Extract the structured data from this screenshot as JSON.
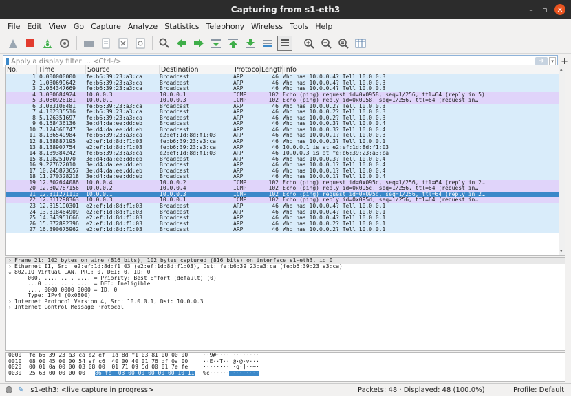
{
  "title": "Capturing from s1-eth3",
  "menu": [
    "File",
    "Edit",
    "View",
    "Go",
    "Capture",
    "Analyze",
    "Statistics",
    "Telephony",
    "Wireless",
    "Tools",
    "Help"
  ],
  "filter_placeholder": "Apply a display filter … <Ctrl-/>",
  "columns": [
    "No.",
    "Time",
    "Source",
    "Destination",
    "Protocol",
    "Length",
    "Info"
  ],
  "packets": [
    {
      "no": "1",
      "time": "0.000000000",
      "src": "fe:b6:39:23:a3:ca",
      "dst": "Broadcast",
      "proto": "ARP",
      "len": "46",
      "info": "Who has 10.0.0.4? Tell 10.0.0.3",
      "bg": "#d9ecfa"
    },
    {
      "no": "2",
      "time": "1.030699642",
      "src": "fe:b6:39:23:a3:ca",
      "dst": "Broadcast",
      "proto": "ARP",
      "len": "46",
      "info": "Who has 10.0.0.4? Tell 10.0.0.3",
      "bg": "#d9ecfa"
    },
    {
      "no": "3",
      "time": "2.054347669",
      "src": "fe:b6:39:23:a3:ca",
      "dst": "Broadcast",
      "proto": "ARP",
      "len": "46",
      "info": "Who has 10.0.0.4? Tell 10.0.0.3",
      "bg": "#d9ecfa"
    },
    {
      "no": "4",
      "time": "3.080684924",
      "src": "10.0.0.3",
      "dst": "10.0.0.1",
      "proto": "ICMP",
      "len": "102",
      "info": "Echo (ping) request  id=0x0958, seq=1/256, ttl=64 (reply in 5)",
      "bg": "#e0d4fa"
    },
    {
      "no": "5",
      "time": "3.080926181",
      "src": "10.0.0.1",
      "dst": "10.0.0.3",
      "proto": "ICMP",
      "len": "102",
      "info": "Echo (ping) reply    id=0x0958, seq=1/256, ttl=64 (request in…",
      "bg": "#e0d4fa"
    },
    {
      "no": "6",
      "time": "3.083108481",
      "src": "fe:b6:39:23:a3:ca",
      "dst": "Broadcast",
      "proto": "ARP",
      "len": "46",
      "info": "Who has 10.0.0.2? Tell 10.0.0.3",
      "bg": "#d9ecfa"
    },
    {
      "no": "7",
      "time": "4.102335516",
      "src": "fe:b6:39:23:a3:ca",
      "dst": "Broadcast",
      "proto": "ARP",
      "len": "46",
      "info": "Who has 10.0.0.2? Tell 10.0.0.3",
      "bg": "#d9ecfa"
    },
    {
      "no": "8",
      "time": "5.126351697",
      "src": "fe:b6:39:23:a3:ca",
      "dst": "Broadcast",
      "proto": "ARP",
      "len": "46",
      "info": "Who has 10.0.0.2? Tell 10.0.0.3",
      "bg": "#d9ecfa"
    },
    {
      "no": "9",
      "time": "6.158436136",
      "src": "3e:d4:da:ee:dd:eb",
      "dst": "Broadcast",
      "proto": "ARP",
      "len": "46",
      "info": "Who has 10.0.0.3? Tell 10.0.0.4",
      "bg": "#d9ecfa"
    },
    {
      "no": "10",
      "time": "7.174366747",
      "src": "3e:d4:da:ee:dd:eb",
      "dst": "Broadcast",
      "proto": "ARP",
      "len": "46",
      "info": "Who has 10.0.0.3? Tell 10.0.0.4",
      "bg": "#d9ecfa"
    },
    {
      "no": "11",
      "time": "8.136549984",
      "src": "fe:b6:39:23:a3:ca",
      "dst": "e2:ef:1d:8d:f1:03",
      "proto": "ARP",
      "len": "46",
      "info": "Who has 10.0.0.1? Tell 10.0.0.3",
      "bg": "#d9ecfa"
    },
    {
      "no": "12",
      "time": "8.138887195",
      "src": "e2:ef:1d:8d:f1:03",
      "dst": "fe:b6:39:23:a3:ca",
      "proto": "ARP",
      "len": "46",
      "info": "Who has 10.0.0.3? Tell 10.0.0.1",
      "bg": "#d9ecfa"
    },
    {
      "no": "13",
      "time": "8.138907754",
      "src": "e2:ef:1d:8d:f1:03",
      "dst": "fe:b6:39:23:a3:ca",
      "proto": "ARP",
      "len": "46",
      "info": "10.0.0.1 is at e2:ef:1d:8d:f1:03",
      "bg": "#d9ecfa"
    },
    {
      "no": "14",
      "time": "8.139384242",
      "src": "fe:b6:39:23:a3:ca",
      "dst": "e2:ef:1d:8d:f1:03",
      "proto": "ARP",
      "len": "46",
      "info": "10.0.0.3 is at fe:b6:39:23:a3:ca",
      "bg": "#d9ecfa"
    },
    {
      "no": "15",
      "time": "8.198251070",
      "src": "3e:d4:da:ee:dd:eb",
      "dst": "Broadcast",
      "proto": "ARP",
      "len": "46",
      "info": "Who has 10.0.0.3? Tell 10.0.0.4",
      "bg": "#d9ecfa"
    },
    {
      "no": "16",
      "time": "9.227622010",
      "src": "3e:d4:da:ee:dd:eb",
      "dst": "Broadcast",
      "proto": "ARP",
      "len": "46",
      "info": "Who has 10.0.0.1? Tell 10.0.0.4",
      "bg": "#d9ecfa"
    },
    {
      "no": "17",
      "time": "10.245873657",
      "src": "3e:d4:da:ee:dd:eb",
      "dst": "Broadcast",
      "proto": "ARP",
      "len": "46",
      "info": "Who has 10.0.0.1? Tell 10.0.0.4",
      "bg": "#d9ecfa"
    },
    {
      "no": "18",
      "time": "11.270328218",
      "src": "3e:d4:da:ee:dd:eb",
      "dst": "Broadcast",
      "proto": "ARP",
      "len": "46",
      "info": "Who has 10.0.0.1? Tell 10.0.0.4",
      "bg": "#d9ecfa"
    },
    {
      "no": "19",
      "time": "12.302644086",
      "src": "10.0.0.4",
      "dst": "10.0.0.2",
      "proto": "ICMP",
      "len": "102",
      "info": "Echo (ping) request  id=0x095c, seq=1/256, ttl=64 (reply in 2…",
      "bg": "#e0d4fa"
    },
    {
      "no": "20",
      "time": "12.302787156",
      "src": "10.0.0.2",
      "dst": "10.0.0.4",
      "proto": "ICMP",
      "len": "102",
      "info": "Echo (ping) reply    id=0x095c, seq=1/256, ttl=64 (request in…",
      "bg": "#e0d4fa"
    },
    {
      "no": "21",
      "time": "12.311271113",
      "src": "10.0.0.1",
      "dst": "10.0.0.3",
      "proto": "ICMP",
      "len": "102",
      "info": "Echo (ping) request  id=0x095d, seq=1/256, ttl=64 (reply in 2…",
      "bg": "#3b88c9",
      "sel": true
    },
    {
      "no": "22",
      "time": "12.311298363",
      "src": "10.0.0.3",
      "dst": "10.0.0.1",
      "proto": "ICMP",
      "len": "102",
      "info": "Echo (ping) reply    id=0x095d, seq=1/256, ttl=64 (request in…",
      "bg": "#e0d4fa"
    },
    {
      "no": "23",
      "time": "12.315190301",
      "src": "e2:ef:1d:8d:f1:03",
      "dst": "Broadcast",
      "proto": "ARP",
      "len": "46",
      "info": "Who has 10.0.0.4? Tell 10.0.0.1",
      "bg": "#d9ecfa"
    },
    {
      "no": "24",
      "time": "13.318464909",
      "src": "e2:ef:1d:8d:f1:03",
      "dst": "Broadcast",
      "proto": "ARP",
      "len": "46",
      "info": "Who has 10.0.0.4? Tell 10.0.0.1",
      "bg": "#d9ecfa"
    },
    {
      "no": "25",
      "time": "14.343951666",
      "src": "e2:ef:1d:8d:f1:03",
      "dst": "Broadcast",
      "proto": "ARP",
      "len": "46",
      "info": "Who has 10.0.0.4? Tell 10.0.0.1",
      "bg": "#d9ecfa"
    },
    {
      "no": "26",
      "time": "15.372892396",
      "src": "e2:ef:1d:8d:f1:03",
      "dst": "Broadcast",
      "proto": "ARP",
      "len": "46",
      "info": "Who has 10.0.0.2? Tell 10.0.0.1",
      "bg": "#d9ecfa"
    },
    {
      "no": "27",
      "time": "16.390675962",
      "src": "e2:ef:1d:8d:f1:03",
      "dst": "Broadcast",
      "proto": "ARP",
      "len": "46",
      "info": "Who has 10.0.0.2? Tell 10.0.0.1",
      "bg": "#d9ecfa"
    }
  ],
  "details": [
    {
      "arrow": "›",
      "text": "Frame 21: 102 bytes on wire (816 bits), 102 bytes captured (816 bits) on interface s1-eth3, id 0"
    },
    {
      "arrow": "›",
      "text": "Ethernet II, Src: e2:ef:1d:8d:f1:03 (e2:ef:1d:8d:f1:03), Dst: fe:b6:39:23:a3:ca (fe:b6:39:23:a3:ca)"
    },
    {
      "arrow": "⌄",
      "text": "802.1Q Virtual LAN, PRI: 0, DEI: 0, ID: 0"
    },
    {
      "arrow": "",
      "text": "    000. .... .... .... = Priority: Best Effort (default) (0)"
    },
    {
      "arrow": "",
      "text": "    ...0 .... .... .... = DEI: Ineligible"
    },
    {
      "arrow": "",
      "text": "    .... 0000 0000 0000 = ID: 0"
    },
    {
      "arrow": "",
      "text": "    Type: IPv4 (0x0800)"
    },
    {
      "arrow": "›",
      "text": "Internet Protocol Version 4, Src: 10.0.0.1, Dst: 10.0.0.3"
    },
    {
      "arrow": "›",
      "text": "Internet Control Message Protocol"
    }
  ],
  "hex": [
    {
      "off": "0000",
      "bytes": "fe b6 39 23 a3 ca e2 ef  1d 8d f1 03 81 00 00 00",
      "ascii": "··9#···· ········"
    },
    {
      "off": "0010",
      "bytes": "08 00 45 00 00 54 af c6  40 00 40 01 76 df 0a 00",
      "ascii": "··E··T·· @·@·v···"
    },
    {
      "off": "0020",
      "bytes": "00 01 0a 00 00 03 08 00  01 71 09 5d 00 01 7e fe",
      "ascii": "········ ·q·]··~·"
    },
    {
      "off": "0030",
      "bytes_plain": "25 63 00 00 00 00 ",
      "bytes_sel": "86 fc  03 00 00 00 00 00 10 11",
      "ascii_plain": "%c······",
      "ascii_sel": " ········"
    }
  ],
  "status": {
    "text": "s1-eth3: <live capture in progress>",
    "packets": "Packets: 48 · Displayed: 48 (100.0%)",
    "profile": "Profile: Default"
  },
  "colors": {
    "arp_bg": "#d9ecfa",
    "icmp_bg": "#e0d4fa",
    "selected_bg": "#3b88c9",
    "titlebar": "#2c2c2c",
    "close_button": "#e95420"
  }
}
